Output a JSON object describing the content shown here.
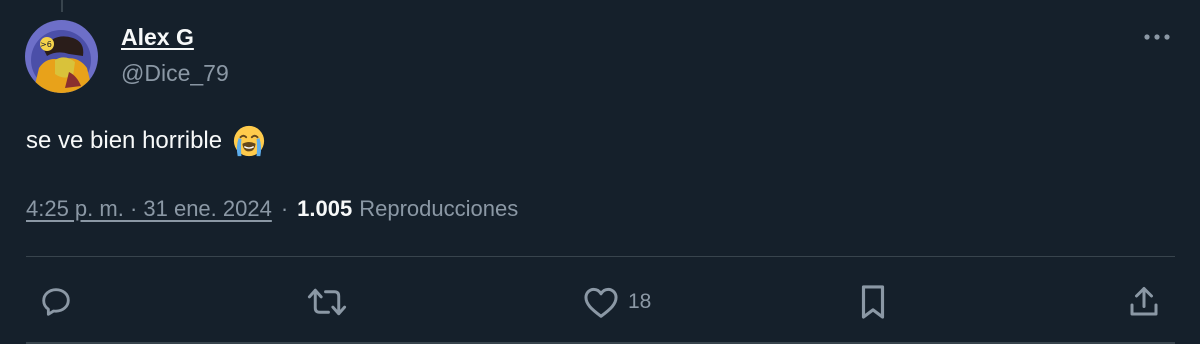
{
  "author": {
    "display_name": "Alex G",
    "handle": "@Dice_79"
  },
  "tweet": {
    "text": "se ve bien horrible",
    "emoji": "loudly-crying-face"
  },
  "meta": {
    "timestamp": "4:25 p. m. · 31 ene. 2024",
    "separator": "·",
    "views_count": "1.005",
    "views_label": "Reproducciones"
  },
  "actions": {
    "like_count": "18",
    "icons": [
      "reply-icon",
      "retweet-icon",
      "like-icon",
      "bookmark-icon",
      "share-icon"
    ]
  },
  "colors": {
    "background": "#15202b",
    "text_primary": "#f7f9f9",
    "text_secondary": "#8b98a5",
    "divider": "#38444d"
  }
}
